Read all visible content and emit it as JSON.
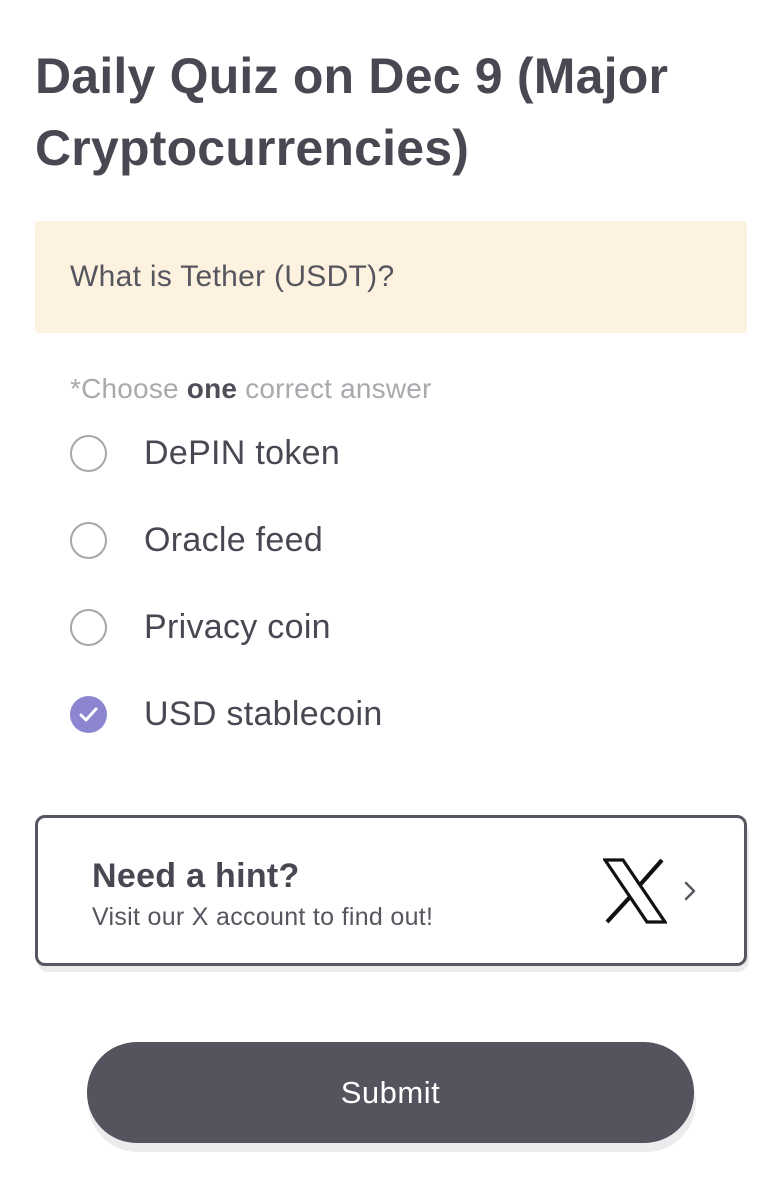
{
  "quiz": {
    "title": "Daily Quiz on Dec 9 (Major Cryptocurrencies)",
    "question": "What is Tether (USDT)?",
    "instruction": {
      "prefix": "*Choose ",
      "emphasis": "one",
      "suffix": " correct answer"
    },
    "options": [
      {
        "label": "DePIN token",
        "selected": false
      },
      {
        "label": "Oracle feed",
        "selected": false
      },
      {
        "label": "Privacy coin",
        "selected": false
      },
      {
        "label": "USD stablecoin",
        "selected": true
      }
    ]
  },
  "hint": {
    "title": "Need a hint?",
    "subtitle": "Visit our X account to find out!",
    "icon": "x-logo-icon",
    "chevron_icon": "chevron-right-icon"
  },
  "actions": {
    "submit_label": "Submit"
  },
  "colors": {
    "question_bg": "#fdf2df",
    "selected_accent": "#8b86cf",
    "button_bg": "#53545e",
    "text_primary": "#474852",
    "text_muted": "#a9a9ae"
  }
}
